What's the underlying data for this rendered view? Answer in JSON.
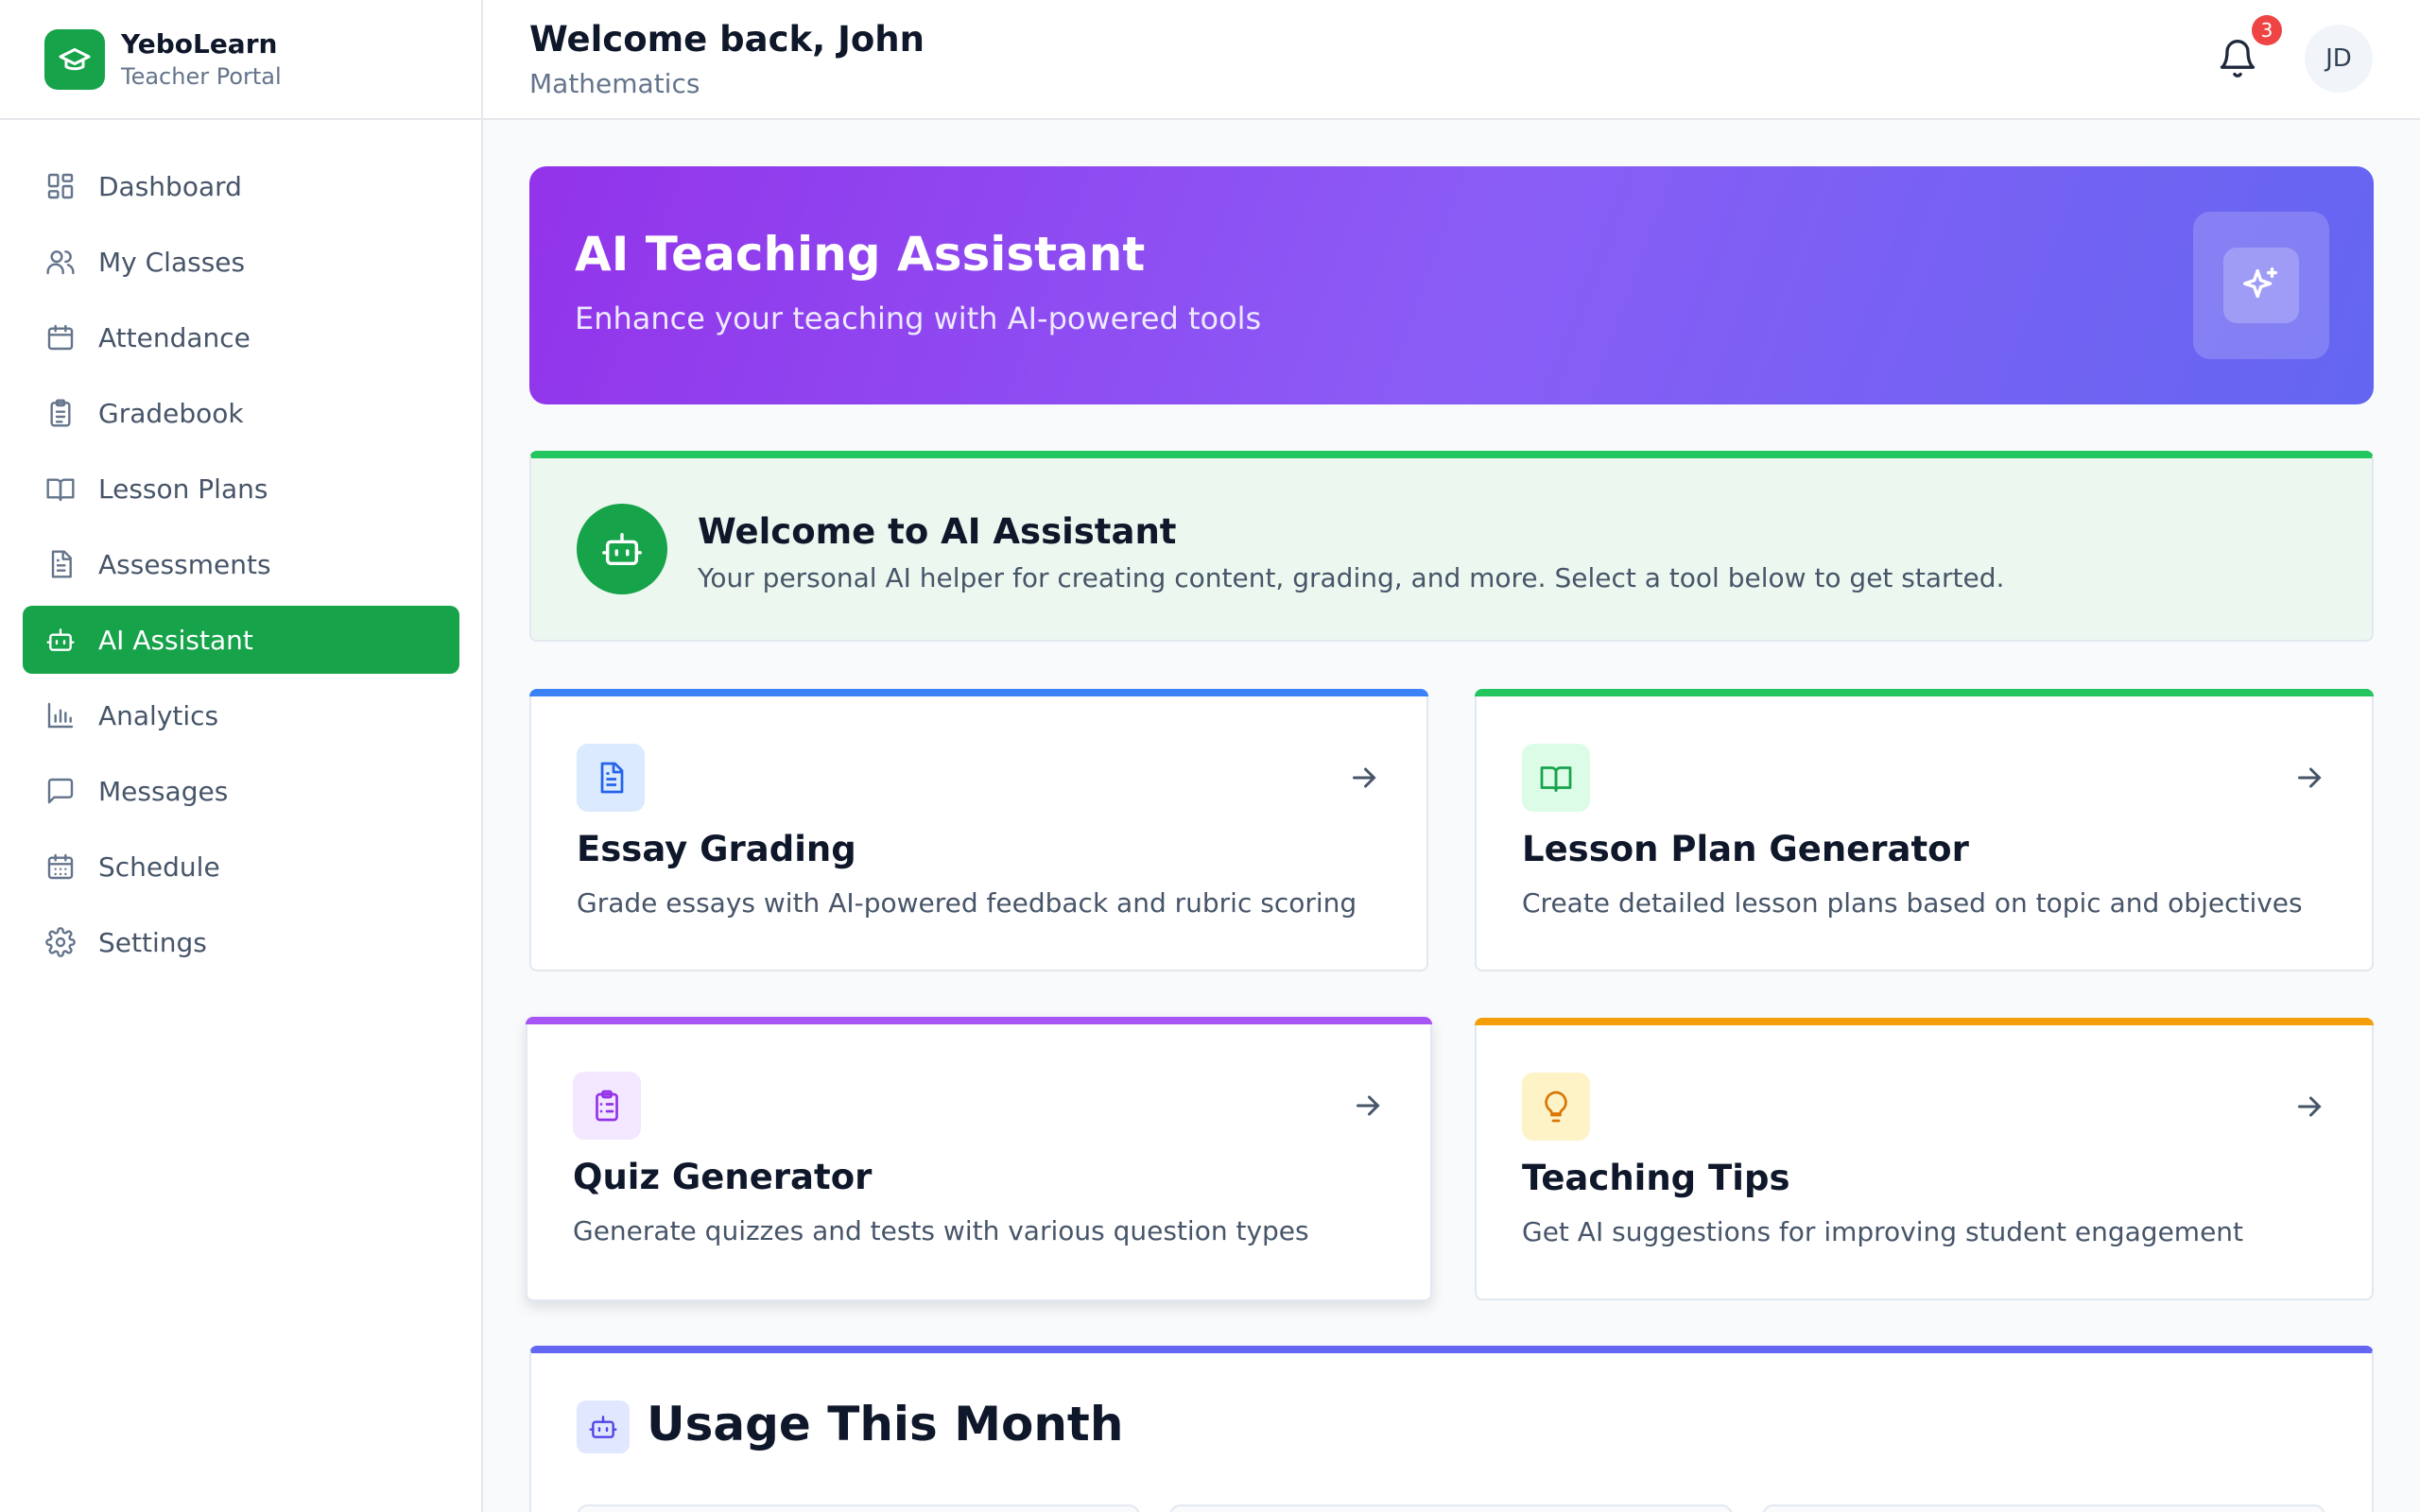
{
  "brand": {
    "name": "YeboLearn",
    "subtitle": "Teacher Portal"
  },
  "sidebar": {
    "items": [
      {
        "label": "Dashboard",
        "icon": "dashboard-icon"
      },
      {
        "label": "My Classes",
        "icon": "users-icon"
      },
      {
        "label": "Attendance",
        "icon": "calendar-icon"
      },
      {
        "label": "Gradebook",
        "icon": "clipboard-icon"
      },
      {
        "label": "Lesson Plans",
        "icon": "book-icon"
      },
      {
        "label": "Assessments",
        "icon": "document-icon"
      },
      {
        "label": "AI Assistant",
        "icon": "bot-icon",
        "active": true
      },
      {
        "label": "Analytics",
        "icon": "bar-chart-icon"
      },
      {
        "label": "Messages",
        "icon": "message-icon"
      },
      {
        "label": "Schedule",
        "icon": "calendar-grid-icon"
      },
      {
        "label": "Settings",
        "icon": "gear-icon"
      }
    ]
  },
  "header": {
    "title": "Welcome back, John",
    "subtitle": "Mathematics",
    "notification_count": "3",
    "avatar_initials": "JD"
  },
  "hero": {
    "title": "AI Teaching Assistant",
    "subtitle": "Enhance your teaching with AI-powered tools"
  },
  "welcome": {
    "title": "Welcome to AI Assistant",
    "description": "Your personal AI helper for creating content, grading, and more. Select a tool below to get started."
  },
  "tools": [
    {
      "title": "Essay Grading",
      "description": "Grade essays with AI-powered feedback and rubric scoring",
      "icon": "document-icon",
      "accent": "#3b82f6"
    },
    {
      "title": "Lesson Plan Generator",
      "description": "Create detailed lesson plans based on topic and objectives",
      "icon": "book-open-icon",
      "accent": "#22c55e"
    },
    {
      "title": "Quiz Generator",
      "description": "Generate quizzes and tests with various question types",
      "icon": "clipboard-list-icon",
      "accent": "#a855f7"
    },
    {
      "title": "Teaching Tips",
      "description": "Get AI suggestions for improving student engagement",
      "icon": "lightbulb-icon",
      "accent": "#f59e0b"
    }
  ],
  "usage": {
    "title": "Usage This Month"
  },
  "colors": {
    "primary_green": "#16a34a",
    "hero_gradient_start": "#9333ea",
    "hero_gradient_end": "#6366f1",
    "notification_red": "#ef4444"
  }
}
